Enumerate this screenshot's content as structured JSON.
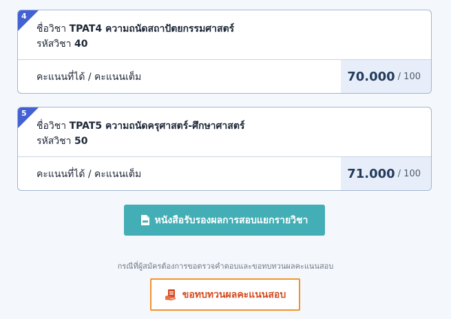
{
  "cards": [
    {
      "number": "4",
      "name_prefix": "ชื่อวิชา",
      "name": "TPAT4 ความถนัดสถาปัตยกรรมศาสตร์",
      "code_prefix": "รหัสวิชา",
      "code": "40",
      "score_label": "คะแนนที่ได้ / คะแนนเต็ม",
      "score": "70.000",
      "full": "/ 100"
    },
    {
      "number": "5",
      "name_prefix": "ชื่อวิชา",
      "name": "TPAT5 ความถนัดครุศาสตร์-ศึกษาศาสตร์",
      "code_prefix": "รหัสวิชา",
      "code": "50",
      "score_label": "คะแนนที่ได้ / คะแนนเต็ม",
      "score": "71.000",
      "full": "/ 100"
    }
  ],
  "certificate_button": {
    "label": "หนังสือรับรองผลการสอบแยกรายวิชา",
    "icon": "pdf-file-icon"
  },
  "review_note": "กรณีที่ผู้สมัครต้องการขอตรวจคำตอบและขอทบทวนผลคะแนนสอบ",
  "review_button": {
    "label": "ขอทบทวนผลคะแนนสอบ",
    "icon": "hand-document-icon"
  },
  "colors": {
    "accent_blue": "#4461d4",
    "teal_button": "#43aeb5",
    "orange_border": "#f0922a",
    "orange_text": "#d44a1f"
  }
}
